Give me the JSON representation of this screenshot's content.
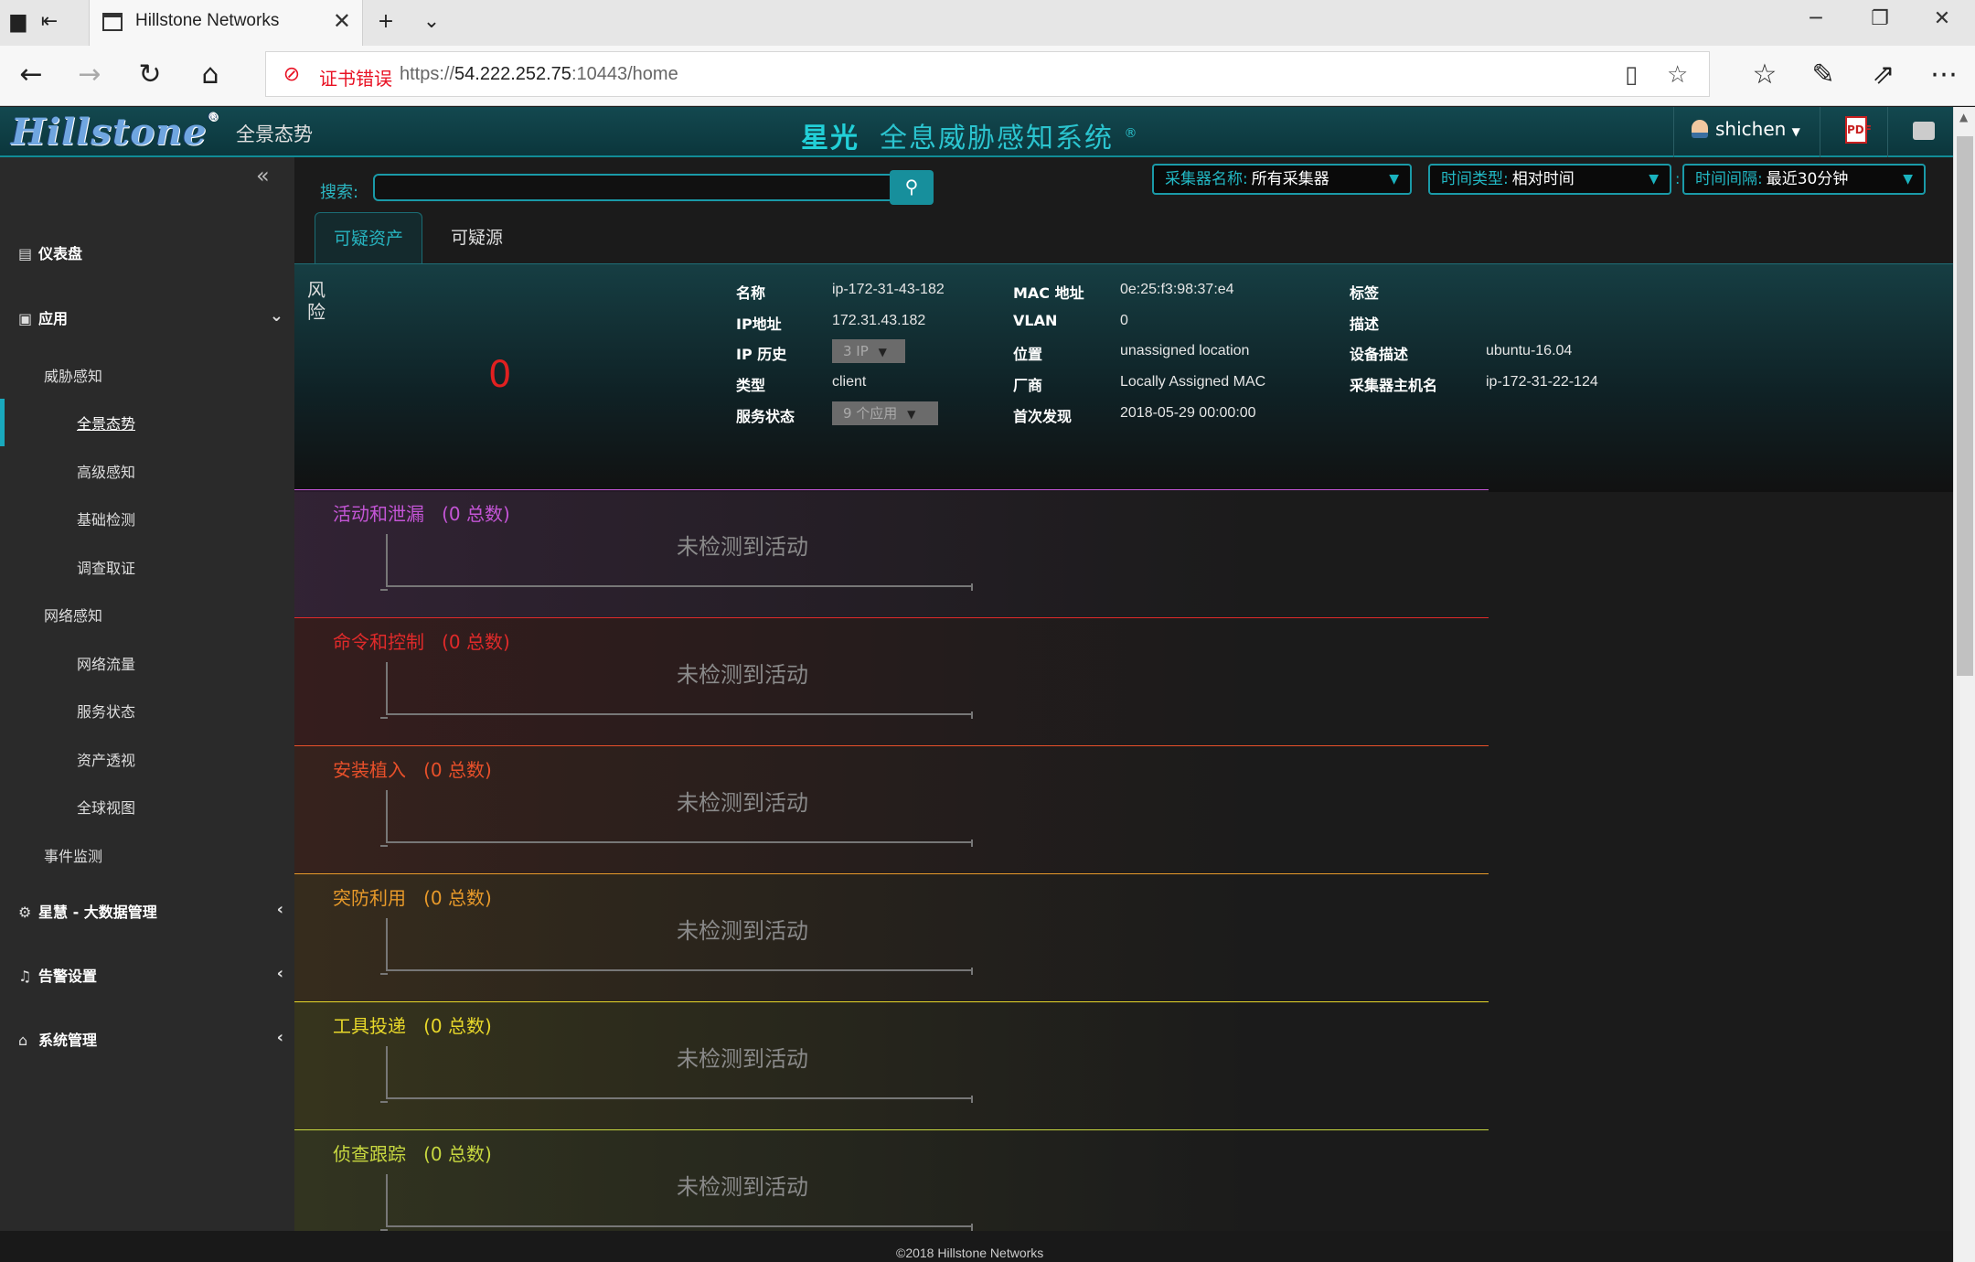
{
  "browser": {
    "tab_title": "Hillstone Networks",
    "cert_error": "证书错误",
    "url_scheme": "https://",
    "url_host": "54.222.252.75",
    "url_rest": ":10443/home"
  },
  "header": {
    "logo": "Hillstone",
    "nav_link": "全景态势",
    "brand_prefix": "星光",
    "brand_name": "全息威胁感知系统",
    "brand_reg": "®",
    "username": "shichen"
  },
  "sidebar": {
    "dashboard": "仪表盘",
    "apps": "应用",
    "threat": "威胁感知",
    "overview": "全景态势",
    "advanced": "高级感知",
    "basic": "基础检测",
    "forensics": "调查取证",
    "network": "网络感知",
    "traffic": "网络流量",
    "service_status": "服务状态",
    "asset_view": "资产透视",
    "global_view": "全球视图",
    "event_monitor": "事件监测",
    "bigdata": "星慧 - 大数据管理",
    "alerts": "告警设置",
    "system": "系统管理"
  },
  "toolbar": {
    "search_label": "搜索:",
    "collector_label": "采集器名称:",
    "collector_value": "所有采集器",
    "time_type_label": "时间类型:",
    "time_type_value": "相对时间",
    "interval_label": "时间间隔:",
    "interval_value": "最近30分钟"
  },
  "tabs": {
    "suspicious_assets": "可疑资产",
    "suspicious_sources": "可疑源"
  },
  "asset": {
    "risk_label": "风险",
    "risk_value": "0",
    "name_key": "名称",
    "name_val": "ip-172-31-43-182",
    "ip_key": "IP地址",
    "ip_val": "172.31.43.182",
    "ip_hist_key": "IP 历史",
    "ip_hist_val": "3 IP",
    "type_key": "类型",
    "type_val": "client",
    "svc_key": "服务状态",
    "svc_val": "9 个应用",
    "mac_key": "MAC 地址",
    "mac_val": "0e:25:f3:98:37:e4",
    "vlan_key": "VLAN",
    "vlan_val": "0",
    "loc_key": "位置",
    "loc_val": "unassigned location",
    "vendor_key": "厂商",
    "vendor_val": "Locally Assigned MAC",
    "first_key": "首次发现",
    "first_val": "2018-05-29 00:00:00",
    "tag_key": "标签",
    "desc_key": "描述",
    "dev_desc_key": "设备描述",
    "dev_desc_val": "ubuntu-16.04",
    "collector_host_key": "采集器主机名",
    "collector_host_val": "ip-172-31-22-124"
  },
  "activities": [
    {
      "title": "活动和泄漏",
      "count": "(0 总数)",
      "empty": "未检测到活动",
      "color": "#c455d6"
    },
    {
      "title": "命令和控制",
      "count": "(0 总数)",
      "empty": "未检测到活动",
      "color": "#e02a2a"
    },
    {
      "title": "安装植入",
      "count": "(0 总数)",
      "empty": "未检测到活动",
      "color": "#e8502a"
    },
    {
      "title": "突防利用",
      "count": "(0 总数)",
      "empty": "未检测到活动",
      "color": "#e89a2a"
    },
    {
      "title": "工具投递",
      "count": "(0 总数)",
      "empty": "未检测到活动",
      "color": "#e8d82a"
    },
    {
      "title": "侦查跟踪",
      "count": "(0 总数)",
      "empty": "未检测到活动",
      "color": "#c8d840"
    }
  ],
  "footer": "©2018 Hillstone Networks"
}
